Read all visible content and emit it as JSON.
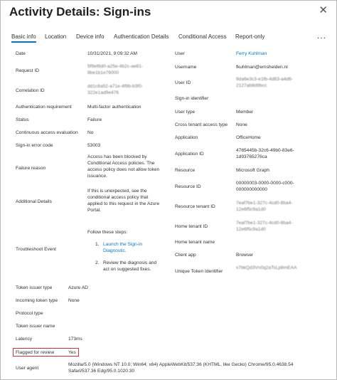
{
  "header": {
    "title": "Activity Details: Sign-ins",
    "close_icon": "close-icon"
  },
  "tabs": [
    {
      "label": "Basic info",
      "active": true
    },
    {
      "label": "Location"
    },
    {
      "label": "Device info"
    },
    {
      "label": "Authentication Details"
    },
    {
      "label": "Conditional Access"
    },
    {
      "label": "Report-only"
    }
  ],
  "more_label": "...",
  "left": {
    "date_label": "Date",
    "date": "10/31/2021, 9:09:32 AM",
    "request_id_label": "Request ID",
    "request_id": "5f9ef8d0-a25e-4b2c-ae81-8be1b1e76000",
    "correlation_id_label": "Correlation ID",
    "correlation_id": "dd1c6a52-a71e-4f9b-b3f0-322e1ad9e476",
    "auth_req_label": "Authentication requirement",
    "auth_req": "Multi-factor authentication",
    "status_label": "Status",
    "status": "Failure",
    "cae_label": "Continuous access evaluation",
    "cae": "No",
    "error_code_label": "Sign-in error code",
    "error_code": "53003",
    "failure_reason_label": "Failure reason",
    "failure_reason": "Access has been blocked by Conditional Access policies. The access policy does not allow token issuance.",
    "additional_details_label": "Additional Details",
    "additional_details": "If this is unexpected, see the conditional access policy that applied to this request in the Azure Portal.",
    "troubleshoot_label": "Troubleshoot Event",
    "troubleshoot_intro": "Follow these steps:",
    "step1_num": "1.",
    "step1": "Launch the Sign-in Diagnostic.",
    "step2_num": "2.",
    "step2": "Review the diagnosis and act on suggested fixes.",
    "token_issuer_type_label": "Token issuer type",
    "token_issuer_type": "Azure AD",
    "incoming_token_type_label": "Incoming token type",
    "incoming_token_type": "None",
    "protocol_type_label": "Protocol type",
    "token_issuer_name_label": "Token issuer name",
    "latency_label": "Latency",
    "latency": "173ms",
    "flagged_label": "Flagged for review",
    "flagged": "Yes",
    "user_agent_label": "User agent",
    "user_agent": "Mozilla/5.0 (Windows NT 10.0; Win64; x64) AppleWebKit/537.36 (KHTML, like Gecko) Chrome/95.0.4638.54 Safari/537.36 Edg/95.0.1020.30"
  },
  "right": {
    "user_label": "User",
    "user": "Ferry Kuhlman",
    "username_label": "Username",
    "username": "fkuhlman@emshelden.nl",
    "user_id_label": "User ID",
    "user_id": "9da6e3c3-e1fb-4d83-a4d6-2127ab8d9bcc",
    "signin_identifier_label": "Sign-in identifier",
    "user_type_label": "User type",
    "user_type": "Member",
    "cross_tenant_label": "Cross tenant access type",
    "cross_tenant": "None",
    "application_label": "Application",
    "application": "OfficeHome",
    "application_id_label": "Application ID",
    "application_id": "4765445b-32c6-49b0-83e6-1d93765276ca",
    "resource_label": "Resource",
    "resource": "Microsoft Graph",
    "resource_id_label": "Resource ID",
    "resource_id": "00000003-0000-0000-c000-000000000000",
    "resource_tenant_id_label": "Resource tenant ID",
    "resource_tenant_id": "7eaf7be1-327c-4cd0-8ba4-12e6f5c9a1d0",
    "home_tenant_id_label": "Home tenant ID",
    "home_tenant_id": "7eaf7be1-327c-4cd0-8ba4-12e6f5c9a1d0",
    "home_tenant_name_label": "Home tenant name",
    "client_app_label": "Client app",
    "client_app": "Browser",
    "unique_token_label": "Unique Token Identifier",
    "unique_token": "x7bkQd3Vn0q2aTsLp8mEAA"
  }
}
